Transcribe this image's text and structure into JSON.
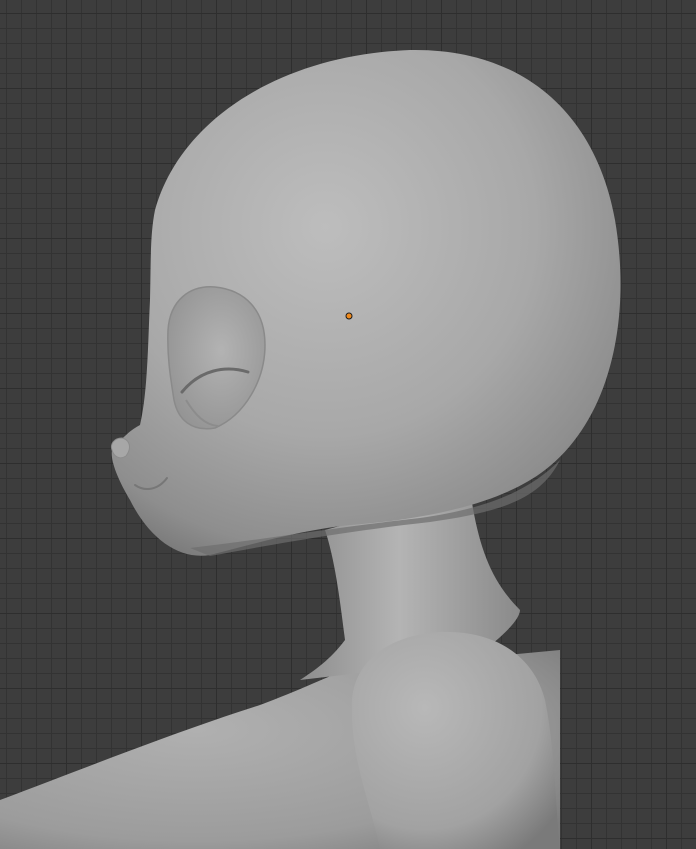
{
  "viewport": {
    "background_color": "#3d3d3d",
    "grid_major_color": "#2e2e2e",
    "grid_minor_color": "#333333",
    "shading_color": "#a3a3a3",
    "origin_marker_color": "#f08a1c"
  },
  "object": {
    "shading": "solid",
    "origin_marker": "object-origin-icon"
  }
}
